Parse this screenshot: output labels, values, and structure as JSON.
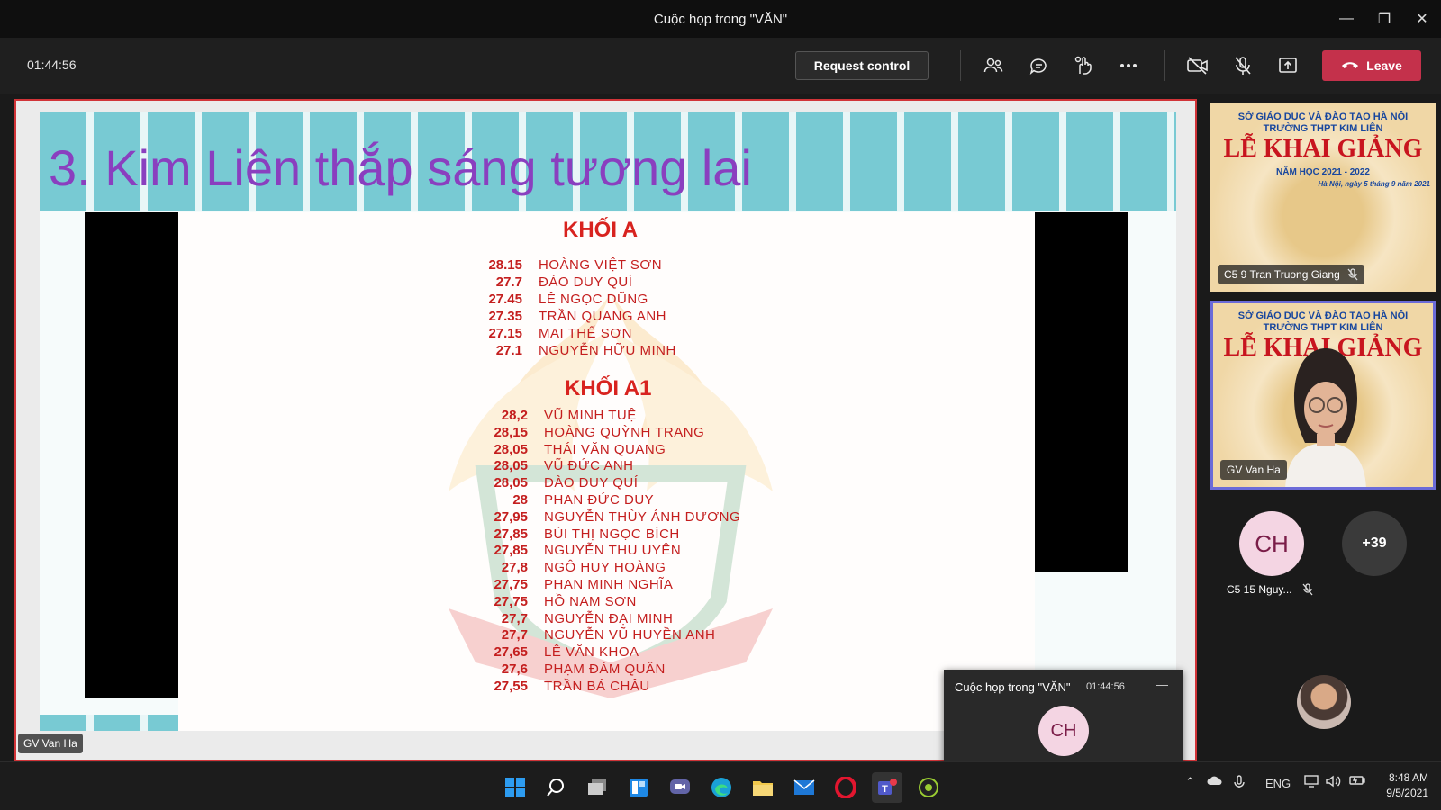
{
  "window": {
    "title": "Cuộc họp trong \"VĂN\""
  },
  "toolbar": {
    "timer": "01:44:56",
    "request_control": "Request control",
    "leave": "Leave"
  },
  "presenter_label": "GV Van Ha",
  "slide": {
    "title": "3. Kim Liên thắp sáng tương lai",
    "blocks": [
      {
        "heading": "KHỐI A",
        "rows": [
          {
            "score": "28.15",
            "name": "HOÀNG VIỆT SƠN"
          },
          {
            "score": "27.7",
            "name": "ĐÀO DUY QUÍ"
          },
          {
            "score": "27.45",
            "name": "LÊ NGỌC DŨNG"
          },
          {
            "score": "27.35",
            "name": "TRẦN QUANG ANH"
          },
          {
            "score": "27.15",
            "name": "MAI THẾ SƠN"
          },
          {
            "score": "27.1",
            "name": "NGUYỄN HỮU MINH"
          }
        ]
      },
      {
        "heading": "KHỐI A1",
        "rows": [
          {
            "score": "28,2",
            "name": "VŨ MINH TUỆ"
          },
          {
            "score": "28,15",
            "name": "HOÀNG QUỲNH TRANG"
          },
          {
            "score": "28,05",
            "name": "THÁI VĂN QUANG"
          },
          {
            "score": "28,05",
            "name": "VŨ ĐỨC ANH"
          },
          {
            "score": "28,05",
            "name": "ĐÀO DUY QUÍ"
          },
          {
            "score": "28",
            "name": "PHAN ĐỨC DUY"
          },
          {
            "score": "27,95",
            "name": "NGUYỄN THÙY ÁNH DƯƠNG"
          },
          {
            "score": "27,85",
            "name": "BÙI THỊ NGỌC BÍCH"
          },
          {
            "score": "27,85",
            "name": "NGUYỄN THU UYÊN"
          },
          {
            "score": "27,8",
            "name": "NGÔ HUY HOÀNG"
          },
          {
            "score": "27,75",
            "name": "PHAN MINH NGHĨA"
          },
          {
            "score": "27,75",
            "name": "HỒ NAM SƠN"
          },
          {
            "score": "27,7",
            "name": "NGUYỄN ĐẠI MINH"
          },
          {
            "score": "27,7",
            "name": "NGUYỄN VŨ HUYỀN ANH"
          },
          {
            "score": "27,65",
            "name": "LÊ VĂN KHOA"
          },
          {
            "score": "27,6",
            "name": "PHẠM ĐÀM QUÂN"
          },
          {
            "score": "27,55",
            "name": "TRẦN BÁ CHÂU"
          }
        ]
      }
    ]
  },
  "tile_poster": {
    "line1": "SỞ GIÁO DỤC VÀ ĐÀO TẠO HÀ NỘI",
    "line2": "TRƯỜNG THPT KIM LIÊN",
    "headline": "LỄ KHAI GIẢNG",
    "year": "NĂM HỌC 2021 - 2022",
    "date": "Hà Nội, ngày 5 tháng 9 năm 2021"
  },
  "participants": {
    "tile1_name": "C5 9 Tran Truong Giang",
    "tile2_name": "GV Van Ha",
    "avatar_initials": "CH",
    "avatar_name": "C5 15 Nguy...",
    "more_count": "+39"
  },
  "mini_window": {
    "title": "Cuộc họp trong \"VĂN\"",
    "time": "01:44:56",
    "initials": "CH"
  },
  "taskbar": {
    "lang": "ENG",
    "time": "8:48 AM",
    "date": "9/5/2021"
  },
  "colors": {
    "leave": "#c4314b",
    "share_border": "#d13438",
    "slide_title": "#8a3fbf",
    "slide_text": "#c41e1e",
    "active_tile": "#6b6bd8"
  }
}
